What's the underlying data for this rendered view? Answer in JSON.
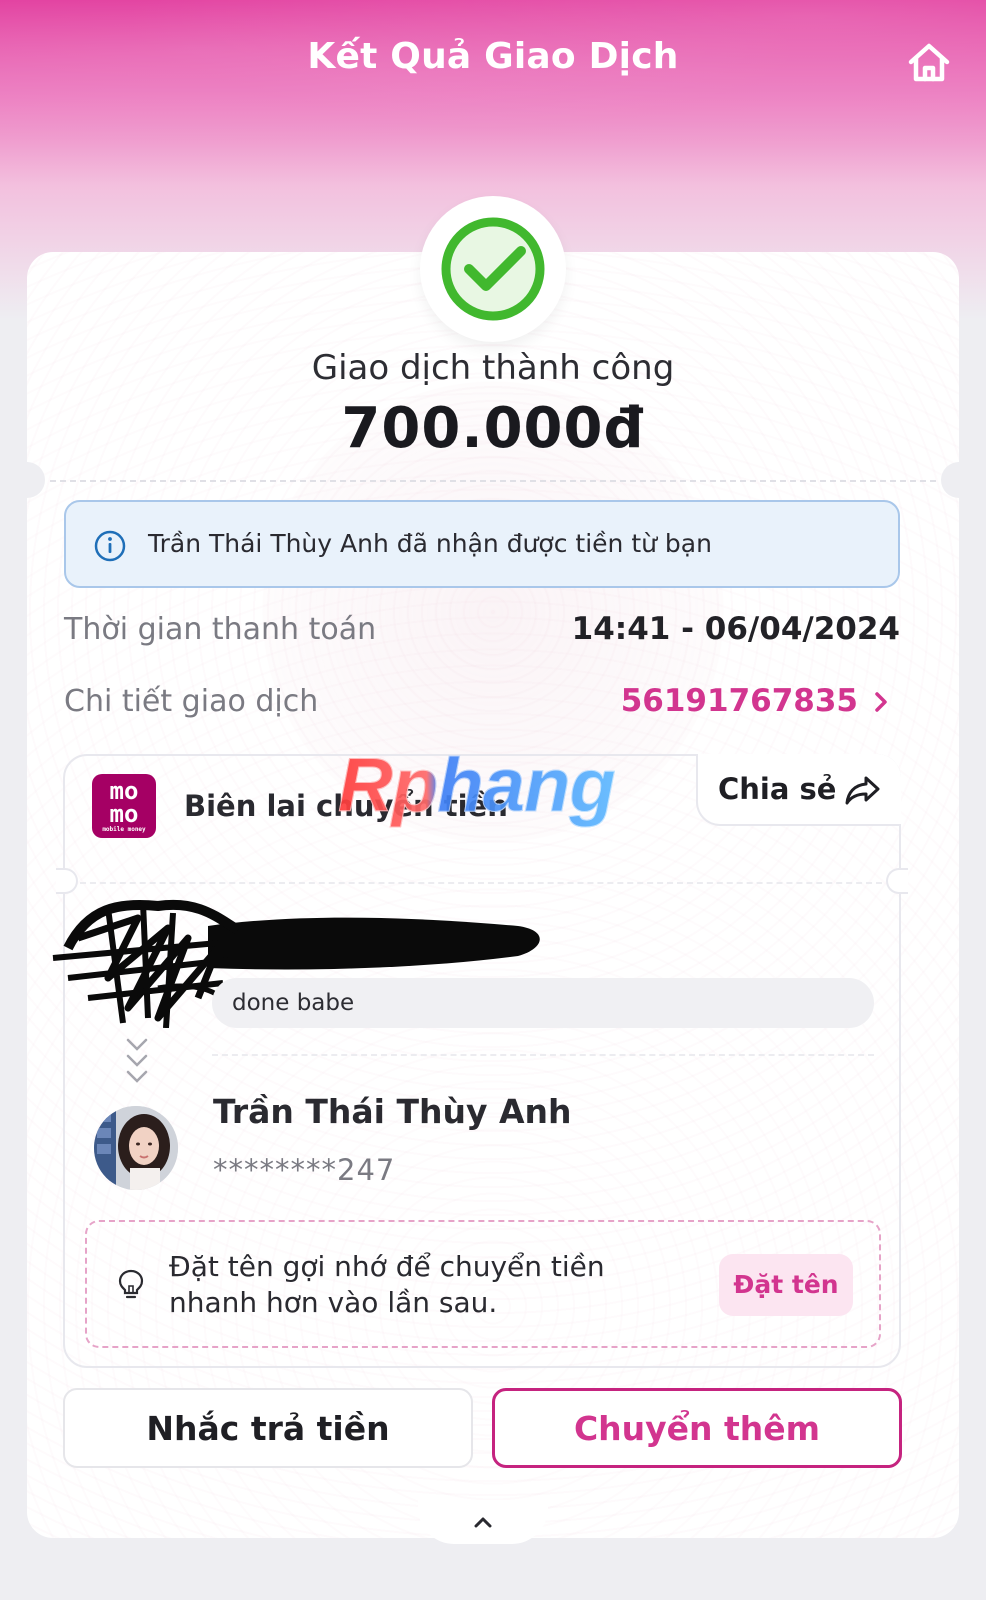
{
  "header": {
    "title": "Kết Quả Giao Dịch",
    "home_icon": "home-icon"
  },
  "result": {
    "status_text": "Giao dịch thành công",
    "amount": "700.000đ",
    "status_icon": "check-circle-icon",
    "status_color": "#41b82e"
  },
  "info_banner": {
    "icon": "info-icon",
    "text": "Trần Thái Thùy Anh đã nhận được tiền từ bạn"
  },
  "details": {
    "time_label": "Thời gian thanh toán",
    "time_value": "14:41 - 06/04/2024",
    "transaction_label": "Chi tiết giao dịch",
    "transaction_id": "56191767835"
  },
  "receipt": {
    "logo_line1": "mo",
    "logo_line2": "mo",
    "logo_line3": "mobile money",
    "title": "Biên lai chuyển tiền",
    "watermark": "Rphang",
    "share_label": "Chia sẻ",
    "message": "done babe",
    "recipient_name": "Trần Thái Thùy Anh",
    "recipient_account": "********247"
  },
  "tip": {
    "line1": "Đặt tên gợi nhớ để chuyển tiền",
    "line2": "nhanh hơn vào lần sau.",
    "button_label": "Đặt tên"
  },
  "actions": {
    "remind_label": "Nhắc trả tiền",
    "transfer_label": "Chuyển thêm"
  },
  "colors": {
    "brand_pink": "#d2358f",
    "momo_purple": "#a50064",
    "info_blue": "#1f6fb8",
    "success_green": "#41b82e"
  }
}
